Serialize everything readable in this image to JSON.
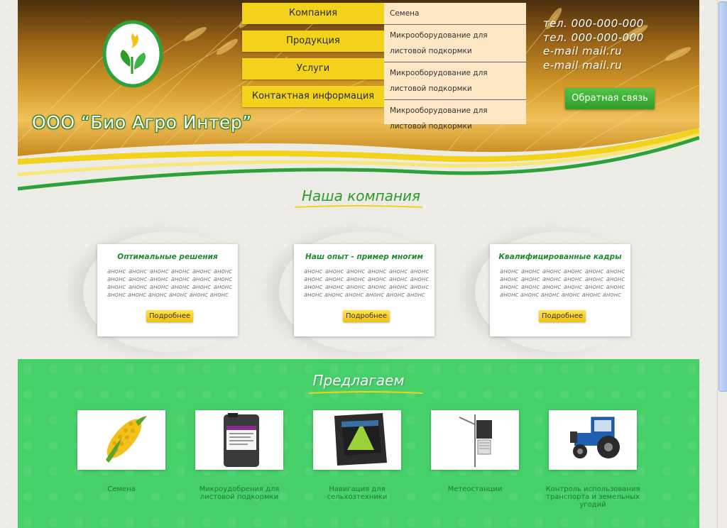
{
  "company": {
    "name": "ООО “Био Агро Интер”"
  },
  "nav": {
    "items": [
      "Компания",
      "Продукция",
      "Услуги",
      "Контактная информация"
    ]
  },
  "submenu": {
    "items": [
      "Семена",
      "Микрооборудование для листовой подкормки",
      "Микрооборудование для листовой подкормки",
      "Микрооборудование для листовой подкормки"
    ]
  },
  "contacts": {
    "lines": [
      "тел. 000-000-000",
      "тел. 000-000-000",
      "e-mail mail.ru",
      "e-mail mail.ru"
    ]
  },
  "feedback_button": "Обратная связь",
  "about": {
    "title": "Наша компания",
    "cards": [
      {
        "title": "Оптимальные решения",
        "text": "анонс анонс анонс анонс анонс анонс анонс анонс анонс анонс анонс анонс анонс анонс анонс анонс анонс анонс анонс анонс анонс анонс анонс анонс",
        "button": "Подробнее"
      },
      {
        "title": "Наш опыт - пример многим",
        "text": "анонс анонс анонс анонс анонс анонс анонс анонс анонс анонс анонс анонс анонс анонс анонс анонс анонс анонс анонс анонс анонс анонс анонс анонс",
        "button": "Подробнее"
      },
      {
        "title": "Квалифицированные кадры",
        "text": "анонс анонс анонс анонс анонс анонс анонс анонс анонс анонс анонс анонс анонс анонс анонс анонс анонс анонс анонс анонс анонс анонс анонс анонс",
        "button": "Подробнее"
      }
    ]
  },
  "offers": {
    "title": "Предлагаем",
    "items": [
      {
        "label": "Семена",
        "icon": "corn-image"
      },
      {
        "label": "Микроудобрения для листовой подкормки",
        "icon": "fertilizer-canister-image"
      },
      {
        "label": "Навигация для сельхозтехники",
        "icon": "navigation-device-image"
      },
      {
        "label": "Метеостанции",
        "icon": "weather-station-image"
      },
      {
        "label": "Контроль использования транспорта и земельных угодий",
        "icon": "tractor-image"
      }
    ]
  },
  "colors": {
    "accent_green": "#2e9b2d",
    "nav_yellow": "#f2d21a",
    "offers_green": "#46d06a",
    "submenu_bg": "#fde7c4"
  }
}
